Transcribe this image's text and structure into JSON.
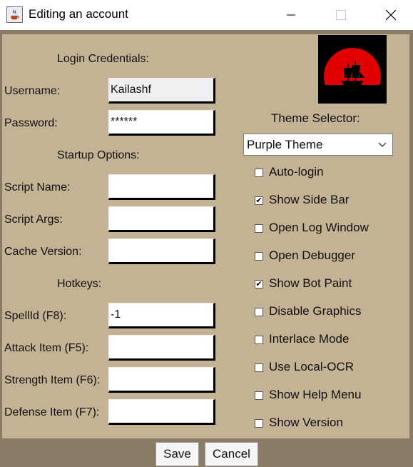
{
  "window": {
    "title": "Editing an account",
    "minimize_icon": "minimize-icon",
    "maximize_icon": "maximize-icon",
    "close_icon": "close-icon"
  },
  "login": {
    "section_title": "Login Credentials:",
    "username_label": "Username:",
    "username_value": "Kailashf",
    "password_label": "Password:",
    "password_value": "******"
  },
  "startup": {
    "section_title": "Startup Options:",
    "script_name_label": "Script Name:",
    "script_name_value": "",
    "script_args_label": "Script Args:",
    "script_args_value": "",
    "cache_version_label": "Cache Version:",
    "cache_version_value": ""
  },
  "hotkeys": {
    "section_title": "Hotkeys:",
    "spellid_label": "SpellId (F8):",
    "spellid_value": "-1",
    "attack_item_label": "Attack Item (F5):",
    "attack_item_value": "",
    "strength_item_label": "Strength Item (F6):",
    "strength_item_value": "",
    "defense_item_label": "Defense Item (F7):",
    "defense_item_value": ""
  },
  "theme": {
    "label": "Theme Selector:",
    "selected": "Purple Theme"
  },
  "options": [
    {
      "label": "Auto-login",
      "checked": false
    },
    {
      "label": "Show Side Bar",
      "checked": true
    },
    {
      "label": "Open Log Window",
      "checked": false
    },
    {
      "label": "Open Debugger",
      "checked": false
    },
    {
      "label": "Show Bot Paint",
      "checked": true
    },
    {
      "label": "Disable Graphics",
      "checked": false
    },
    {
      "label": "Interlace Mode",
      "checked": false
    },
    {
      "label": "Use Local-OCR",
      "checked": false
    },
    {
      "label": "Show Help Menu",
      "checked": false
    },
    {
      "label": "Show Version",
      "checked": false
    }
  ],
  "buttons": {
    "save": "Save",
    "cancel": "Cancel"
  },
  "colors": {
    "panel_background": "#c3b294",
    "frame_border": "#8a7b66",
    "logo_sun": "#e10000"
  }
}
